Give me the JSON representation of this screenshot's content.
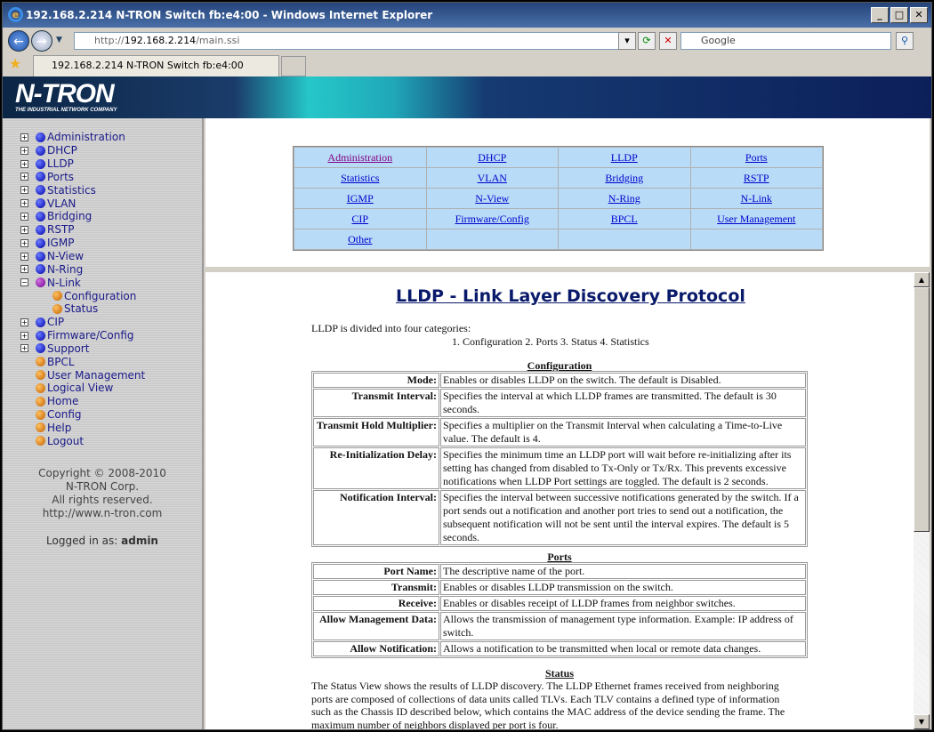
{
  "window": {
    "title": "192.168.2.214 N-TRON Switch fb:e4:00 - Windows Internet Explorer",
    "address_prefix": "http://",
    "address_host": "192.168.2.214",
    "address_path": "/main.ssi",
    "search_placeholder": "Google",
    "tab_title": "192.168.2.214 N-TRON Switch fb:e4:00"
  },
  "banner": {
    "logo": "N-TRON",
    "tagline": "THE INDUSTRIAL NETWORK COMPANY"
  },
  "sidebar": {
    "items": [
      {
        "label": "Administration",
        "type": "folder"
      },
      {
        "label": "DHCP",
        "type": "folder"
      },
      {
        "label": "LLDP",
        "type": "folder"
      },
      {
        "label": "Ports",
        "type": "folder"
      },
      {
        "label": "Statistics",
        "type": "folder"
      },
      {
        "label": "VLAN",
        "type": "folder"
      },
      {
        "label": "Bridging",
        "type": "folder"
      },
      {
        "label": "RSTP",
        "type": "folder"
      },
      {
        "label": "IGMP",
        "type": "folder"
      },
      {
        "label": "N-View",
        "type": "folder"
      },
      {
        "label": "N-Ring",
        "type": "folder"
      },
      {
        "label": "N-Link",
        "type": "open"
      },
      {
        "label": "Configuration",
        "type": "child"
      },
      {
        "label": "Status",
        "type": "child"
      },
      {
        "label": "CIP",
        "type": "folder"
      },
      {
        "label": "Firmware/Config",
        "type": "folder"
      },
      {
        "label": "Support",
        "type": "folder"
      },
      {
        "label": "BPCL",
        "type": "leaf"
      },
      {
        "label": "User Management",
        "type": "leaf"
      },
      {
        "label": "Logical View",
        "type": "leaf"
      },
      {
        "label": "Home",
        "type": "leaf"
      },
      {
        "label": "Config",
        "type": "leaf"
      },
      {
        "label": "Help",
        "type": "leaf"
      },
      {
        "label": "Logout",
        "type": "leaf"
      }
    ],
    "copyright": [
      "Copyright © 2008-2010",
      "N-TRON Corp.",
      "All rights reserved.",
      "http://www.n-tron.com"
    ],
    "logged_in_label": "Logged in as:",
    "logged_in_user": "admin"
  },
  "nav_table": [
    [
      "Administration",
      "DHCP",
      "LLDP",
      "Ports"
    ],
    [
      "Statistics",
      "VLAN",
      "Bridging",
      "RSTP"
    ],
    [
      "IGMP",
      "N-View",
      "N-Ring",
      "N-Link"
    ],
    [
      "CIP",
      "Firmware/Config",
      "BPCL",
      "User Management"
    ],
    [
      "Other",
      "",
      "",
      ""
    ]
  ],
  "content": {
    "title": "LLDP - Link Layer Discovery Protocol",
    "intro": "LLDP is divided into four categories:",
    "categories": "1. Configuration  2. Ports  3. Status  4. Statistics",
    "config_heading": "Configuration",
    "config": [
      [
        "Mode:",
        "Enables or disables LLDP on the switch. The default is Disabled."
      ],
      [
        "Transmit Interval:",
        "Specifies the interval at which LLDP frames are transmitted. The default is 30 seconds."
      ],
      [
        "Transmit Hold Multiplier:",
        "Specifies a multiplier on the Transmit Interval when calculating a Time-to-Live value. The default is 4."
      ],
      [
        "Re-Initialization Delay:",
        "Specifies the minimum time an LLDP port will wait before re-initializing after its setting has changed from disabled to Tx-Only or Tx/Rx. This prevents excessive notifications when LLDP Port settings are toggled. The default is 2 seconds."
      ],
      [
        "Notification Interval:",
        "Specifies the interval between successive notifications generated by the switch. If a port sends out a notification and another port tries to send out a notification, the subsequent notification will not be sent until the interval expires. The default is 5 seconds."
      ]
    ],
    "ports_heading": "Ports",
    "ports": [
      [
        "Port Name:",
        "The descriptive name of the port."
      ],
      [
        "Transmit:",
        "Enables or disables LLDP transmission on the switch."
      ],
      [
        "Receive:",
        "Enables or disables receipt of LLDP frames from neighbor switches."
      ],
      [
        "Allow Management Data:",
        "Allows the transmission of management type information. Example: IP address of switch."
      ],
      [
        "Allow Notification:",
        "Allows a notification to be transmitted when local or remote data changes."
      ]
    ],
    "status_heading": "Status",
    "status_text": "The Status View shows the results of LLDP discovery. The LLDP Ethernet frames received from neighboring ports are composed of collections of data units called TLVs. Each TLV contains a defined type of information such as the Chassis ID described below, which contains the MAC address of the device sending the frame. The maximum number of neighbors displayed per port is four."
  }
}
